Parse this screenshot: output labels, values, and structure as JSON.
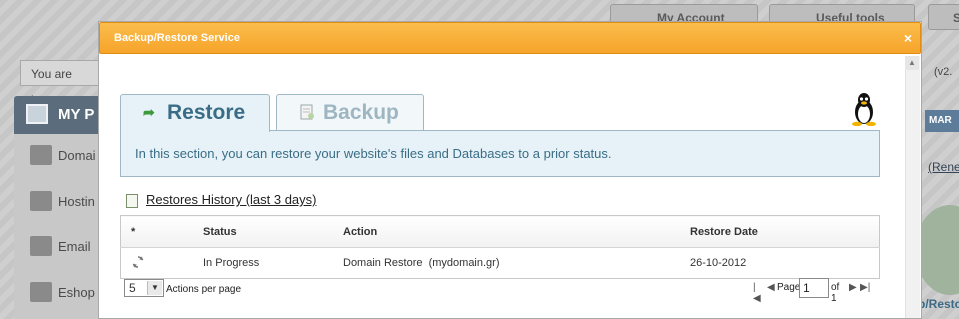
{
  "background": {
    "top_buttons": [
      "My Account",
      "Useful tools",
      "S"
    ],
    "breadcrumb": "You are here",
    "panel_title": "MY P",
    "menu_items": [
      "Domai",
      "Hostin",
      "Email",
      "Eshop"
    ],
    "version": "(v2.",
    "mar_button": "MAR",
    "renew_link": "(Rene",
    "right_bottom_text": "p/Resto"
  },
  "dialog": {
    "title": "Backup/Restore Service",
    "close": "×",
    "tabs": [
      {
        "label": "Restore",
        "active": true
      },
      {
        "label": "Backup",
        "active": false
      }
    ],
    "info_text": "In this section, you can restore your website's files and Databases to a prior status.",
    "history_title": "Restores History (last 3 days)",
    "table": {
      "headers": [
        "*",
        "Status",
        "Action",
        "Restore Date"
      ],
      "rows": [
        {
          "status": "In Progress",
          "action": "Domain Restore  (mydomain.gr)",
          "date": "26-10-2012"
        }
      ]
    },
    "per_page": {
      "value": "5",
      "label": "Actions per page"
    },
    "pager": {
      "page_label": "Page",
      "current": "1",
      "of_label": "of 1"
    }
  },
  "colors": {
    "titlebar": "#f6a42a",
    "tab_text": "#3a6d85",
    "info_bg": "#e6f2f8"
  }
}
